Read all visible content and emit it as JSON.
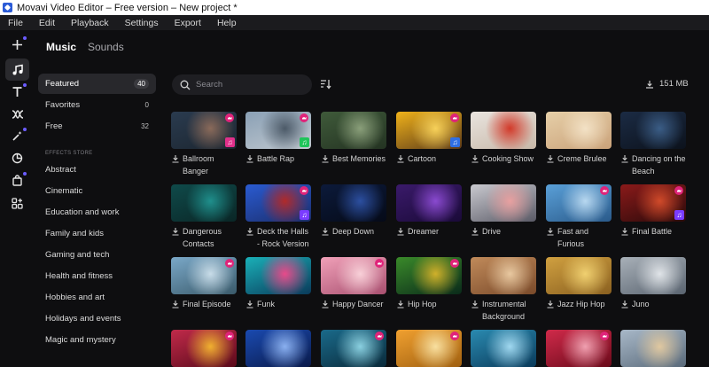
{
  "window": {
    "title": "Movavi Video Editor – Free version – New project *"
  },
  "menu": [
    "File",
    "Edit",
    "Playback",
    "Settings",
    "Export",
    "Help"
  ],
  "tabs": {
    "music": "Music",
    "sounds": "Sounds"
  },
  "sidebar": {
    "items": [
      {
        "label": "Featured",
        "count": "40"
      },
      {
        "label": "Favorites",
        "count": "0"
      },
      {
        "label": "Free",
        "count": "32"
      }
    ],
    "section_title": "EFFECTS STORE",
    "store_items": [
      "Abstract",
      "Cinematic",
      "Education and work",
      "Family and kids",
      "Gaming and tech",
      "Health and fitness",
      "Hobbies and art",
      "Holidays and events",
      "Magic and mystery"
    ]
  },
  "search": {
    "placeholder": "Search"
  },
  "storage": {
    "size": "151 MB"
  },
  "accent_colors": {
    "crown": "#e0247a",
    "note_green": "#1fc45a",
    "note_purple": "#7a3cff",
    "note_blue": "#2f6fe4",
    "note_pink": "#e0308a"
  },
  "tracks": [
    {
      "label": "Ballroom Banger",
      "colors": [
        "#2a3b4f",
        "#8a6a5a",
        "#1c2630"
      ],
      "crown": true,
      "note": "pink"
    },
    {
      "label": "Battle Rap",
      "colors": [
        "#8aa0b5",
        "#4c5a68",
        "#c0c8cf"
      ],
      "crown": true,
      "note": "green"
    },
    {
      "label": "Best Memories",
      "colors": [
        "#3f5a3a",
        "#8a9f7a",
        "#243322"
      ],
      "crown": false,
      "note": ""
    },
    {
      "label": "Cartoon",
      "colors": [
        "#f0b21a",
        "#f7d15a",
        "#5b3a1a"
      ],
      "crown": true,
      "note": "blue"
    },
    {
      "label": "Cooking Show",
      "colors": [
        "#e9e4df",
        "#d23a2a",
        "#c7b8a8"
      ],
      "crown": false,
      "note": ""
    },
    {
      "label": "Creme Brulee",
      "colors": [
        "#e6cfa8",
        "#f3e2c6",
        "#caa27a"
      ],
      "crown": false,
      "note": ""
    },
    {
      "label": "Dancing on the Beach",
      "colors": [
        "#1b2b44",
        "#3b5d86",
        "#0c121c"
      ],
      "crown": false,
      "note": ""
    },
    {
      "label": "Dangerous Contacts",
      "colors": [
        "#0f4a4a",
        "#1f8f8c",
        "#0a2626"
      ],
      "crown": false,
      "note": ""
    },
    {
      "label": "Deck the Halls - Rock Version",
      "colors": [
        "#2a5bd1",
        "#b02a2a",
        "#1b2d6b"
      ],
      "crown": true,
      "note": "purple"
    },
    {
      "label": "Deep Down",
      "colors": [
        "#0c1a3a",
        "#2c4fa0",
        "#050a18"
      ],
      "crown": false,
      "note": ""
    },
    {
      "label": "Dreamer",
      "colors": [
        "#3a1a6a",
        "#8a4ad0",
        "#1a0a38"
      ],
      "crown": false,
      "note": ""
    },
    {
      "label": "Drive",
      "colors": [
        "#c9c9cf",
        "#e8a0a0",
        "#5a5a66"
      ],
      "crown": false,
      "note": ""
    },
    {
      "label": "Fast and Furious",
      "colors": [
        "#5aa0d8",
        "#b8d8f0",
        "#2a5a8a"
      ],
      "crown": true,
      "note": ""
    },
    {
      "label": "Final Battle",
      "colors": [
        "#8a1a1a",
        "#d04a2a",
        "#2a0a0a"
      ],
      "crown": true,
      "note": "purple"
    },
    {
      "label": "Final Episode",
      "colors": [
        "#7aa8c8",
        "#c8dce8",
        "#3a5a6a"
      ],
      "crown": true,
      "note": ""
    },
    {
      "label": "Funk",
      "colors": [
        "#1ab0b8",
        "#e84a8a",
        "#0a3a5a"
      ],
      "crown": false,
      "note": ""
    },
    {
      "label": "Happy Dancer",
      "colors": [
        "#f0a0b8",
        "#f8d0d8",
        "#a85070"
      ],
      "crown": true,
      "note": ""
    },
    {
      "label": "Hip Hop",
      "colors": [
        "#3a8a2a",
        "#d0b02a",
        "#0a2a1a"
      ],
      "crown": true,
      "note": ""
    },
    {
      "label": "Instrumental Background",
      "colors": [
        "#c08a5a",
        "#e8c8a0",
        "#7a4a2a"
      ],
      "crown": false,
      "note": ""
    },
    {
      "label": "Jazz Hip Hop",
      "colors": [
        "#d0a040",
        "#f0d070",
        "#8a6020"
      ],
      "crown": false,
      "note": ""
    },
    {
      "label": "Juno",
      "colors": [
        "#a8b0b8",
        "#e0e4e8",
        "#5a6470"
      ],
      "crown": false,
      "note": ""
    },
    {
      "label": "",
      "colors": [
        "#c02a4a",
        "#f0b030",
        "#5a0a1a"
      ],
      "crown": true,
      "note": ""
    },
    {
      "label": "",
      "colors": [
        "#1a4ab0",
        "#8ab0f0",
        "#0a1a4a"
      ],
      "crown": false,
      "note": ""
    },
    {
      "label": "",
      "colors": [
        "#1a6a8a",
        "#8ad0e0",
        "#0a2a3a"
      ],
      "crown": true,
      "note": ""
    },
    {
      "label": "",
      "colors": [
        "#f0a030",
        "#f8e0a0",
        "#a06010"
      ],
      "crown": true,
      "note": ""
    },
    {
      "label": "",
      "colors": [
        "#2a8ab0",
        "#a0d8f0",
        "#0a3a5a"
      ],
      "crown": false,
      "note": ""
    },
    {
      "label": "",
      "colors": [
        "#d02a4a",
        "#f0a0b0",
        "#6a0a1a"
      ],
      "crown": true,
      "note": ""
    },
    {
      "label": "",
      "colors": [
        "#a8b8c8",
        "#e0c8a0",
        "#5a6a7a"
      ],
      "crown": false,
      "note": ""
    }
  ]
}
